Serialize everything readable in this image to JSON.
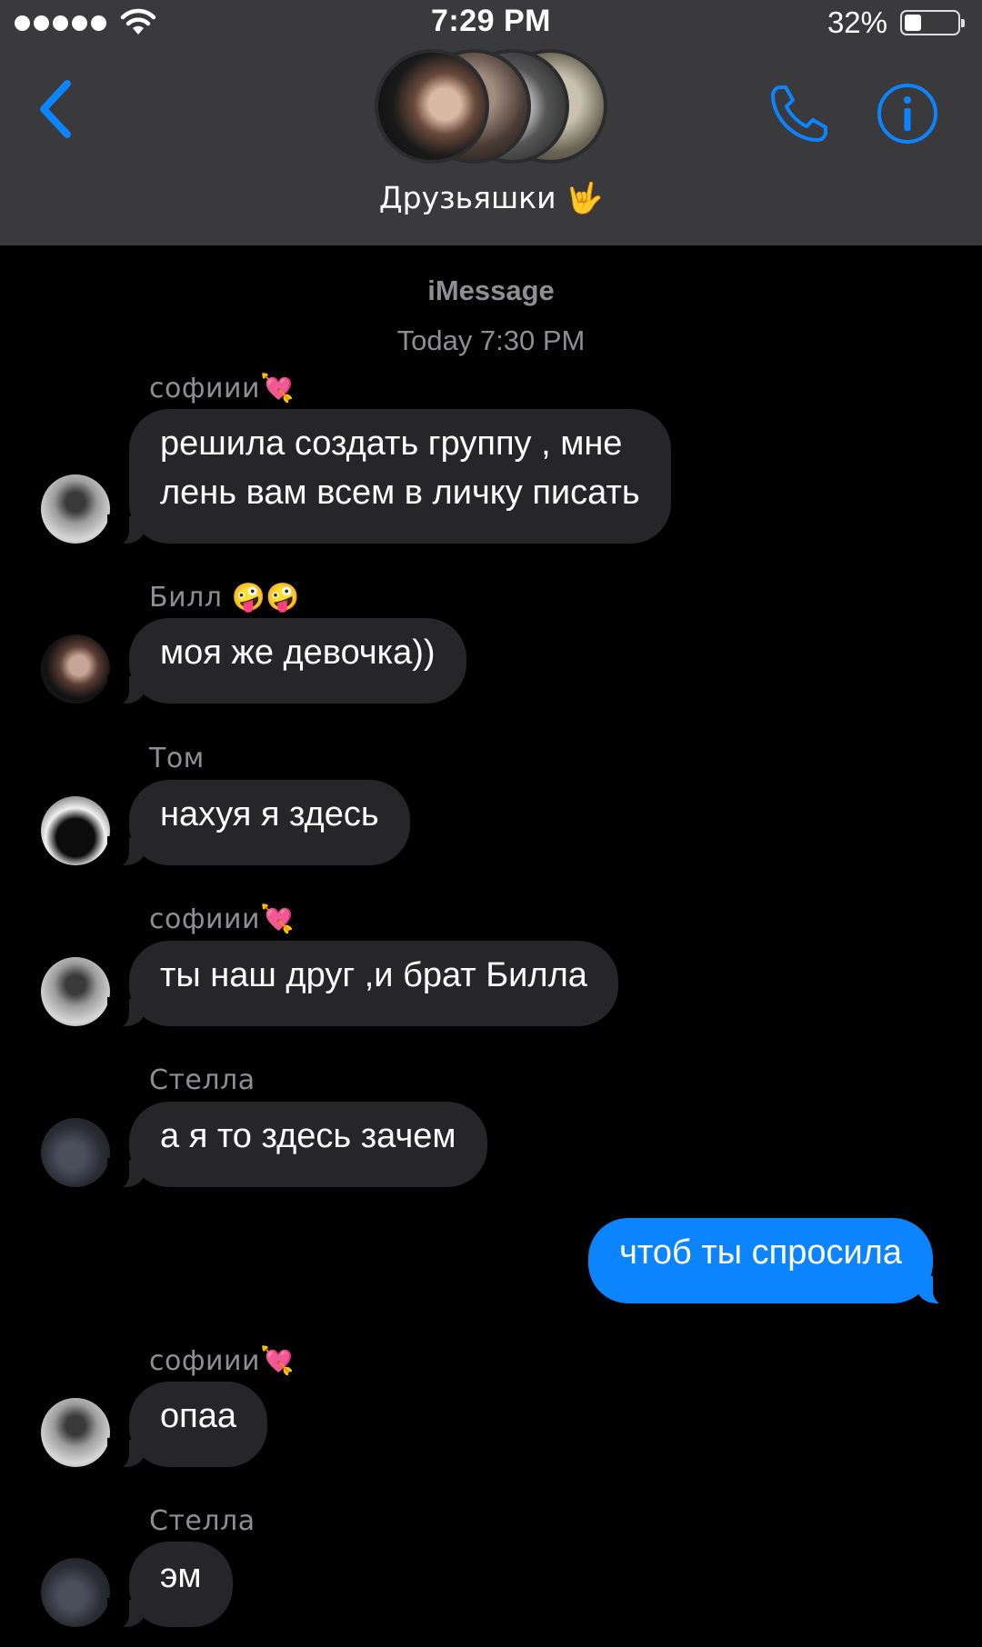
{
  "status_bar": {
    "time": "7:29 PM",
    "battery_percent_text": "32%",
    "battery_level": 0.32,
    "signal_bars": 5
  },
  "header": {
    "group_name": "Друзьяшки 🤟",
    "accent_color": "#0b84fe"
  },
  "conversation": {
    "service": "iMessage",
    "timestamp": "Today 7:30 PM",
    "messages": [
      {
        "sender": "софиии💘",
        "avatar": "sofia",
        "text": "решила создать группу , мне\nлень вам всем в личку писать"
      },
      {
        "sender": "Билл 🤪🤪",
        "avatar": "bill",
        "text": "моя же девочка))"
      },
      {
        "sender": "Том",
        "avatar": "tom",
        "text": "нахуя я здесь"
      },
      {
        "sender": "софиии💘",
        "avatar": "sofia",
        "text": "ты наш друг ,и брат Билла"
      },
      {
        "sender": "Стелла",
        "avatar": "stella",
        "text": "а я то здесь зачем"
      },
      {
        "sender": "",
        "avatar": "",
        "text": "чтоб ты спросила",
        "outgoing": true
      },
      {
        "sender": "софиии💘",
        "avatar": "sofia",
        "text": "опаа"
      },
      {
        "sender": "Стелла",
        "avatar": "stella",
        "text": "эм"
      }
    ]
  },
  "icons": {
    "back": "chevron-left-icon",
    "call": "phone-icon",
    "info": "info-circle-icon",
    "wifi": "wifi-icon",
    "battery": "battery-icon"
  }
}
